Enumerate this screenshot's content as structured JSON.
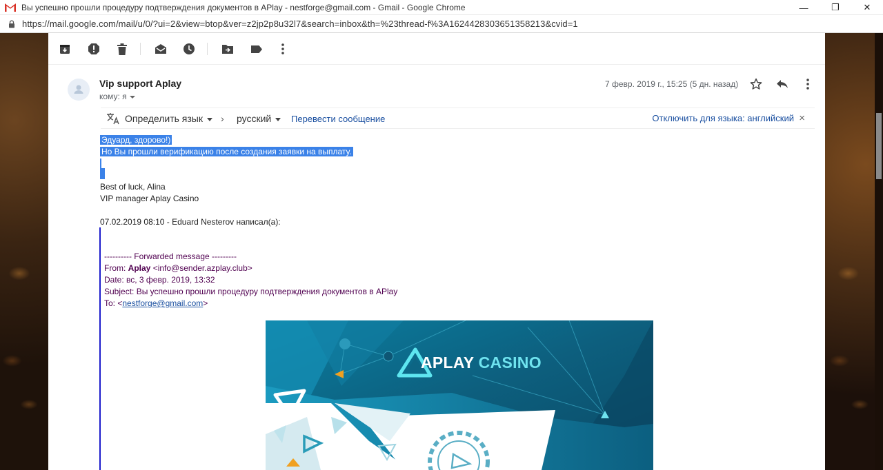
{
  "window": {
    "title": "Вы успешно прошли процедуру подтверждения документов в APlay - nestforge@gmail.com - Gmail - Google Chrome",
    "url": "https://mail.google.com/mail/u/0/?ui=2&view=btop&ver=z2jp2p8u32l7&search=inbox&th=%23thread-f%3A1624428303651358213&cvid=1",
    "minimize": "—",
    "restore": "❐",
    "close": "✕"
  },
  "toolbar": {
    "icons": [
      "archive-icon",
      "report-spam-icon",
      "delete-icon",
      "mark-unread-icon",
      "snooze-icon",
      "move-to-icon",
      "label-icon",
      "more-icon"
    ]
  },
  "message": {
    "sender": "Vip support Aplay",
    "to": "кому: я",
    "date": "7 февр. 2019 г., 15:25 (5 дн. назад)"
  },
  "translate": {
    "detect": "Определить язык",
    "arrow": "›",
    "target": "русский",
    "translate_link": "Перевести сообщение",
    "disable_link": "Отключить для языка: английский",
    "close": "×"
  },
  "body": {
    "line1": "Эдуард, здорово!)",
    "line2": "Но Вы прошли верификацию после создания заявки на выплату.",
    "signoff": "Best of luck, Alina",
    "signature": "VIP manager Aplay Casino",
    "quote_header": "07.02.2019 08:10 - Eduard Nesterov написал(а):"
  },
  "forwarded": {
    "header": "---------- Forwarded message ---------",
    "from_label": "From: ",
    "from_name": "Aplay",
    "from_email": " <info@sender.azplay.club>",
    "date": "Date: вс, 3 февр. 2019, 13:32",
    "subject": "Subject: Вы успешно прошли процедуру подтверждения документов в APlay",
    "to_label": "To: <",
    "to_email": "nestforge@gmail.com",
    "to_close": ">"
  },
  "banner": {
    "brand_word1": "APLAY",
    "brand_word2": "CASINO"
  },
  "colors": {
    "selection": "#3b82e8",
    "link": "#1a4fa0",
    "quote_text": "#500050",
    "banner_teal": "#0f6a85",
    "banner_cyan": "#6fe3ef"
  }
}
